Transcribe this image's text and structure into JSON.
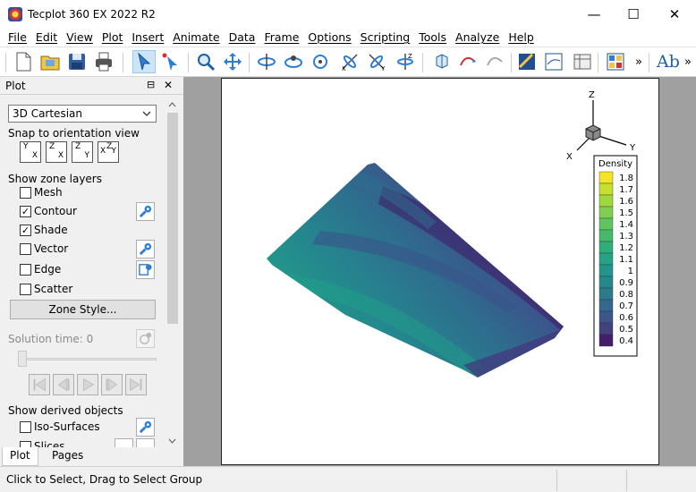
{
  "window": {
    "title": "Tecplot 360 EX 2022 R2",
    "minimize_glyph": "—",
    "maximize_glyph": "☐",
    "close_glyph": "✕"
  },
  "menu": [
    "File",
    "Edit",
    "View",
    "Plot",
    "Insert",
    "Animate",
    "Data",
    "Frame",
    "Options",
    "Scripting",
    "Tools",
    "Analyze",
    "Help"
  ],
  "toolbar": {
    "overflow_glyph": "»",
    "text_tool_label": "Ab"
  },
  "sidebar": {
    "title": "Plot",
    "pin_glyph": "⊟",
    "close_glyph": "✕",
    "plot_type": "3D Cartesian",
    "snap_label": "Snap to orientation view",
    "orient_views": [
      {
        "a": "Y",
        "b": "X"
      },
      {
        "a": "Z",
        "b": "X"
      },
      {
        "a": "Z",
        "b": "Y"
      },
      {
        "a": "Z",
        "b": "Y",
        "c": "X"
      }
    ],
    "zone_layers_label": "Show zone layers",
    "layers": [
      {
        "label": "Mesh",
        "checked": false,
        "glyph": ""
      },
      {
        "label": "Contour",
        "checked": true,
        "glyph": "✓"
      },
      {
        "label": "Shade",
        "checked": true,
        "glyph": "✓"
      },
      {
        "label": "Vector",
        "checked": false,
        "glyph": ""
      },
      {
        "label": "Edge",
        "checked": false,
        "glyph": ""
      },
      {
        "label": "Scatter",
        "checked": false,
        "glyph": ""
      }
    ],
    "zone_style_button": "Zone Style...",
    "solution_time_label": "Solution time: 0",
    "derived_label": "Show derived objects",
    "derived": [
      {
        "label": "Iso-Surfaces",
        "checked": false
      },
      {
        "label": "Slices",
        "checked": false
      }
    ],
    "tabs": [
      "Plot",
      "Pages"
    ]
  },
  "plot": {
    "axis_labels": {
      "z": "Z",
      "x": "X",
      "y": "Y"
    },
    "legend": {
      "title": "Density",
      "levels": [
        "1.8",
        "1.7",
        "1.6",
        "1.5",
        "1.4",
        "1.3",
        "1.2",
        "1.1",
        "1",
        "0.9",
        "0.8",
        "0.7",
        "0.6",
        "0.5",
        "0.4"
      ],
      "colors": [
        "#f3e427",
        "#c6df30",
        "#a0d93c",
        "#7fcf52",
        "#5fc561",
        "#47b96d",
        "#2fae7b",
        "#26a384",
        "#22968b",
        "#25888d",
        "#2b7b8d",
        "#32698c",
        "#3b5689",
        "#43417f",
        "#431f6a"
      ]
    },
    "colormap": [
      "#3f1a66",
      "#45357d",
      "#3b548b",
      "#2e6d8e",
      "#25868e",
      "#20a187"
    ]
  },
  "status": {
    "text": "Click to Select, Drag to Select Group"
  }
}
